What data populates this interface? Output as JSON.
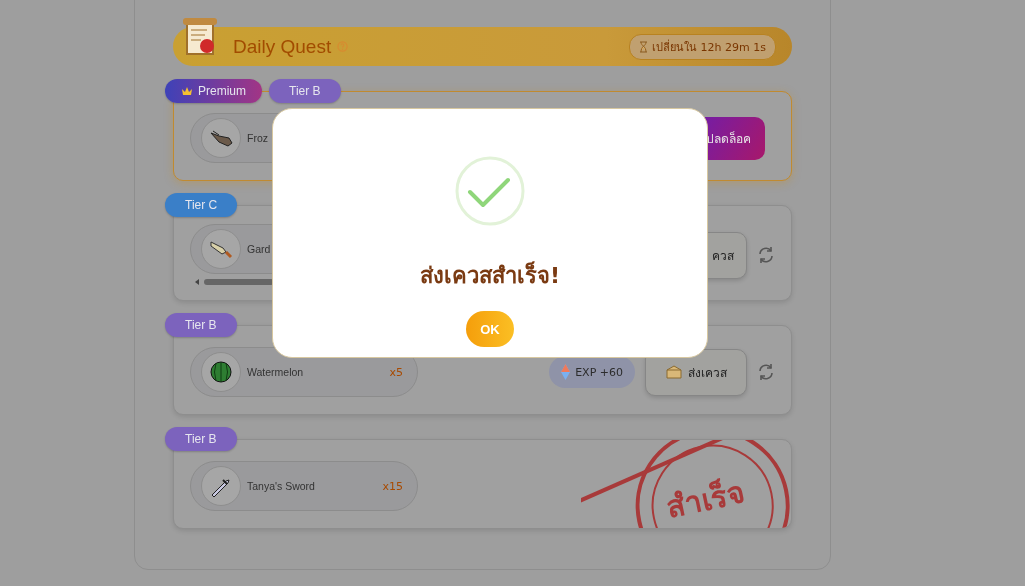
{
  "header": {
    "title": "Daily Quest",
    "timer": "เปลี่ยนใน 12h 29m 1s"
  },
  "quests": [
    {
      "kind": "premium",
      "tags": [
        {
          "kind": "premium",
          "label": "Premium"
        },
        {
          "kind": "tier",
          "label": "Tier B",
          "color": "#7c63bd"
        }
      ],
      "item": {
        "name": "Froz"
      },
      "action": {
        "kind": "unlock",
        "label": "ปลดล็อค"
      },
      "refreshable": false,
      "scrollbar": false,
      "completed": false
    },
    {
      "kind": "normal",
      "tags": [
        {
          "kind": "tier",
          "label": "Tier C",
          "color": "#3a7fc8"
        }
      ],
      "item": {
        "name": "Gard"
      },
      "action": {
        "kind": "submit",
        "label": "ควส"
      },
      "refreshable": true,
      "scrollbar": true,
      "completed": false
    },
    {
      "kind": "normal",
      "tags": [
        {
          "kind": "tier",
          "label": "Tier B",
          "color": "#7c63bd"
        }
      ],
      "item": {
        "name": "Watermelon",
        "count": "x5"
      },
      "reward": "EXP +60",
      "action": {
        "kind": "submit",
        "label": "ส่งเควส"
      },
      "refreshable": true,
      "scrollbar": false,
      "completed": false
    },
    {
      "kind": "normal",
      "tags": [
        {
          "kind": "tier",
          "label": "Tier B",
          "color": "#7c63bd"
        }
      ],
      "item": {
        "name": "Tanya's Sword",
        "count": "x15"
      },
      "refreshable": false,
      "scrollbar": false,
      "completed": true,
      "stamp": "สำเร็จ"
    }
  ],
  "dialog": {
    "message": "ส่งเควสสำเร็จ!",
    "button": "OK"
  }
}
